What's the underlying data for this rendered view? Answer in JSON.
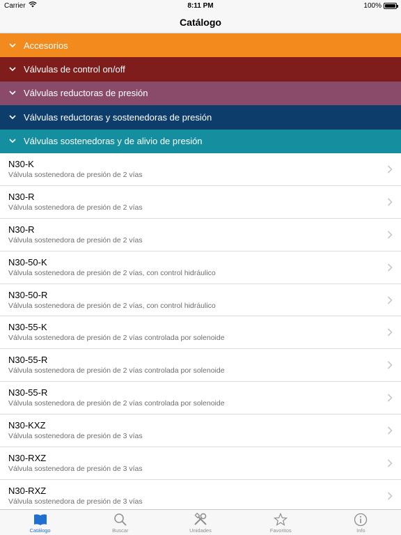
{
  "status_bar": {
    "carrier": "Carrier",
    "time": "8:11 PM",
    "battery": "100%",
    "battery_level": 1.0
  },
  "nav": {
    "title": "Catálogo"
  },
  "sections": [
    {
      "label": "Accesorios",
      "color": "#f28a1e"
    },
    {
      "label": "Válvulas de control on/off",
      "color": "#7f1d1d"
    },
    {
      "label": "Válvulas reductoras de presión",
      "color": "#8a4b6b"
    },
    {
      "label": "Válvulas reductoras y sostenedoras de presión",
      "color": "#0d3d6b"
    },
    {
      "label": "Válvulas sostenedoras y de alivio de presión",
      "color": "#158f9f"
    }
  ],
  "items": [
    {
      "title": "N30-K",
      "subtitle": "Válvula sostenedora de presión de 2 vías"
    },
    {
      "title": "N30-R",
      "subtitle": "Válvula sostenedora de presión de 2 vías"
    },
    {
      "title": "N30-R",
      "subtitle": "Válvula sostenedora de presión de 2 vías"
    },
    {
      "title": "N30-50-K",
      "subtitle": "Válvula sostenedora de presión de 2 vías, con control hidráulico"
    },
    {
      "title": "N30-50-R",
      "subtitle": "Válvula sostenedora de presión de 2 vías, con control hidráulico"
    },
    {
      "title": "N30-55-K",
      "subtitle": "Válvula sostenedora de presión de 2 vías controlada por solenoide"
    },
    {
      "title": "N30-55-R",
      "subtitle": "Válvula sostenedora de presión de 2 vías controlada por solenoide"
    },
    {
      "title": "N30-55-R",
      "subtitle": "Válvula sostenedora de presión de 2 vías controlada por solenoide"
    },
    {
      "title": "N30-KXZ",
      "subtitle": "Válvula sostenedora de presión de 3 vías"
    },
    {
      "title": "N30-RXZ",
      "subtitle": "Válvula sostenedora de presión de 3 vías"
    },
    {
      "title": "N30-RXZ",
      "subtitle": "Válvula sostenedora de presión de 3 vías"
    }
  ],
  "tabs": [
    {
      "label": "Catálogo",
      "icon": "book-icon",
      "active": true
    },
    {
      "label": "Buscar",
      "icon": "search-icon",
      "active": false
    },
    {
      "label": "Unidades",
      "icon": "tools-icon",
      "active": false
    },
    {
      "label": "Favoritos",
      "icon": "star-icon",
      "active": false
    },
    {
      "label": "Info",
      "icon": "info-icon",
      "active": false
    }
  ],
  "colors": {
    "accent": "#1f6fd1",
    "tab_inactive": "#8e8e8e",
    "chevron": "#c7c7cc"
  }
}
